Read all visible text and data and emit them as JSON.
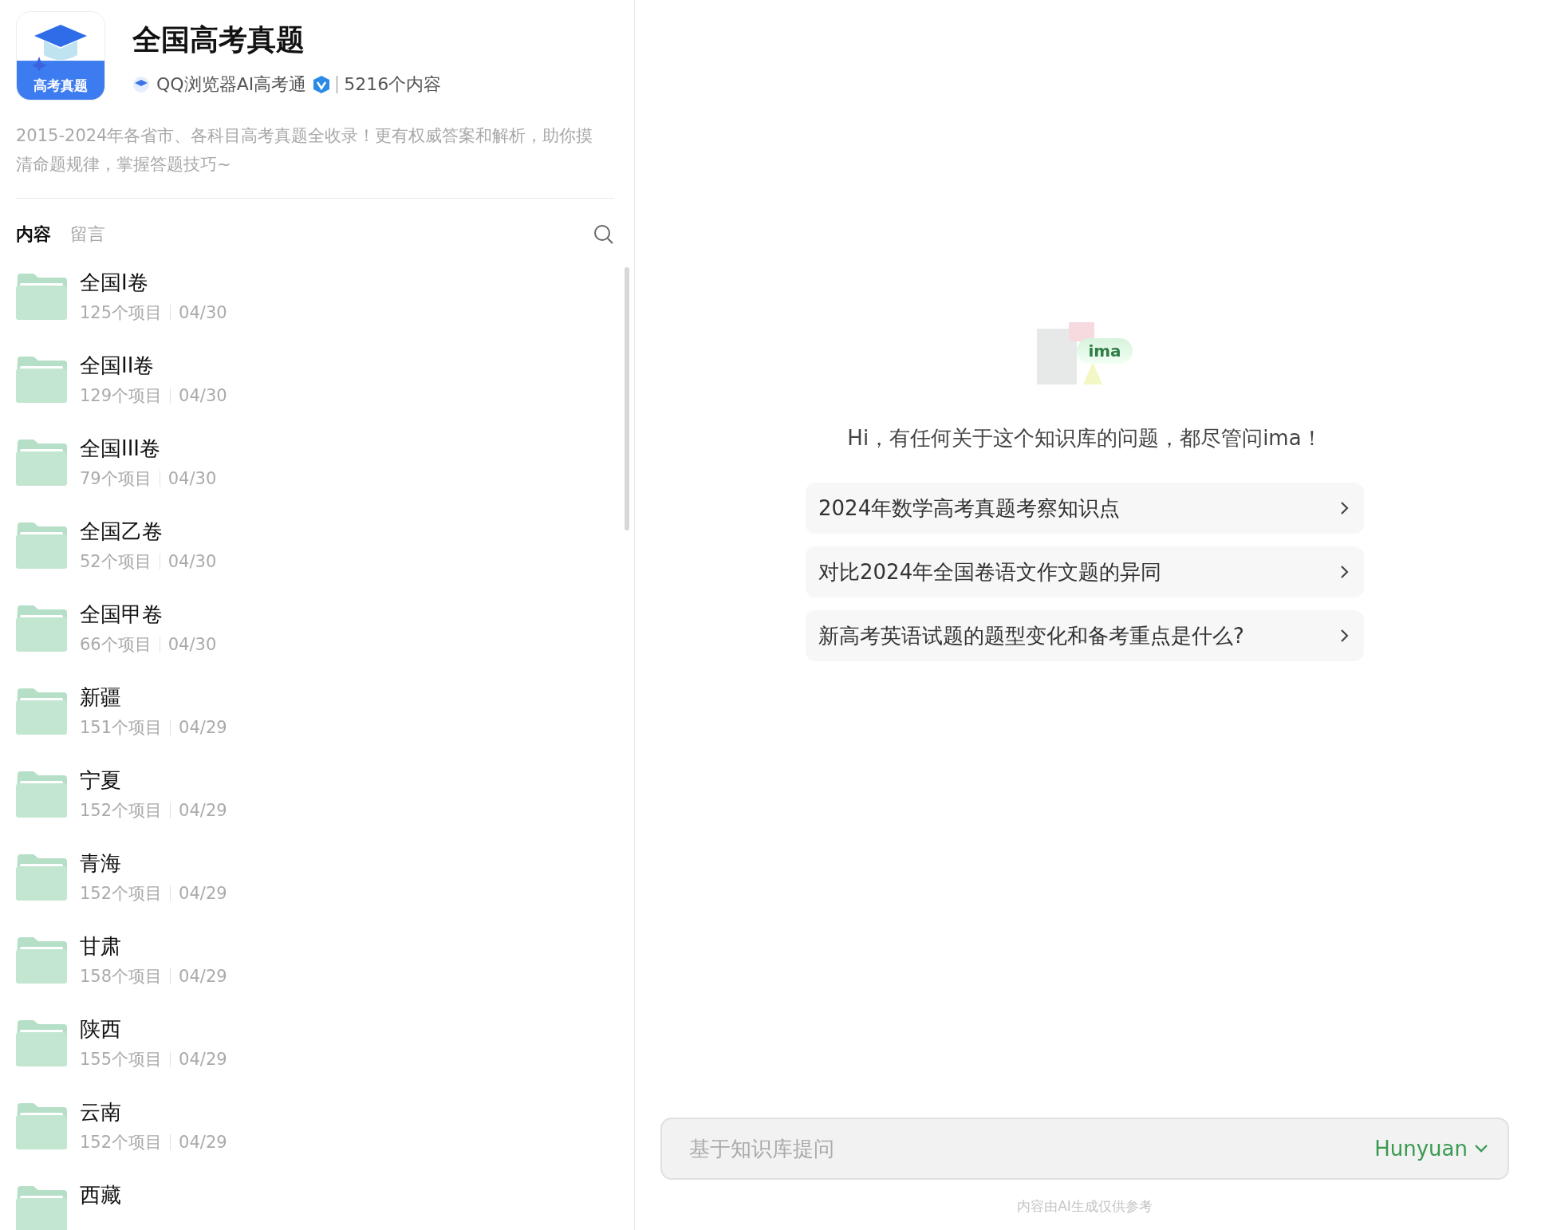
{
  "header": {
    "logo_caption": "高考真题",
    "title": "全国高考真题",
    "author": "QQ浏览器AI高考通",
    "verified": true,
    "count": "5216个内容",
    "description": "2015-2024年各省市、各科目高考真题全收录！更有权威答案和解析，助你摸清命题规律，掌握答题技巧~"
  },
  "tabs": [
    {
      "label": "内容",
      "selected": true
    },
    {
      "label": "留言",
      "selected": false
    }
  ],
  "folders": [
    {
      "name": "全国I卷",
      "items": "125个项目",
      "date": "04/30"
    },
    {
      "name": "全国II卷",
      "items": "129个项目",
      "date": "04/30"
    },
    {
      "name": "全国III卷",
      "items": "79个项目",
      "date": "04/30"
    },
    {
      "name": "全国乙卷",
      "items": "52个项目",
      "date": "04/30"
    },
    {
      "name": "全国甲卷",
      "items": "66个项目",
      "date": "04/30"
    },
    {
      "name": "新疆",
      "items": "151个项目",
      "date": "04/29"
    },
    {
      "name": "宁夏",
      "items": "152个项目",
      "date": "04/29"
    },
    {
      "name": "青海",
      "items": "152个项目",
      "date": "04/29"
    },
    {
      "name": "甘肃",
      "items": "158个项目",
      "date": "04/29"
    },
    {
      "name": "陕西",
      "items": "155个项目",
      "date": "04/29"
    },
    {
      "name": "云南",
      "items": "152个项目",
      "date": "04/29"
    },
    {
      "name": "西藏"
    }
  ],
  "chat": {
    "logo_text": "ima",
    "greeting": "Hi，有任何关于这个知识库的问题，都尽管问ima！",
    "suggestions": [
      "2024年数学高考真题考察知识点",
      "对比2024年全国卷语文作文题的异同",
      "新高考英语试题的题型变化和备考重点是什么?"
    ],
    "input": {
      "placeholder": "基于知识库提问"
    },
    "model": "Hunyuan",
    "disclaimer": "内容由AI生成仅供参考"
  }
}
